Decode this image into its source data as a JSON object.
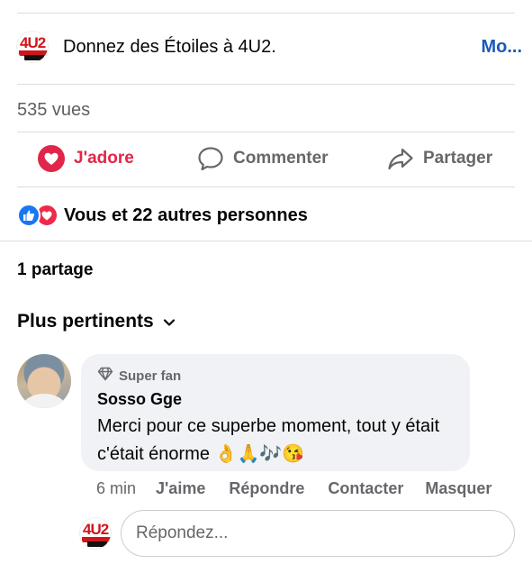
{
  "promo": {
    "page_logo_text": "4U2",
    "text": "Donnez des Étoiles à 4U2.",
    "more_label": "Mo..."
  },
  "stats": {
    "views": "535 vues",
    "reactions_text": "Vous et 22 autres personnes",
    "shares": "1 partage"
  },
  "actions": {
    "love_label": "J'adore",
    "comment_label": "Commenter",
    "share_label": "Partager"
  },
  "sort": {
    "label": "Plus pertinents"
  },
  "comment": {
    "badge": "Super fan",
    "author": "Sosso Gge",
    "text": "Merci pour ce superbe moment, tout y était c'était énorme 👌🙏🎶😘",
    "time": "6 min",
    "like_label": "J'aime",
    "reply_label": "Répondre",
    "contact_label": "Contacter",
    "hide_label": "Masquer"
  },
  "reply": {
    "placeholder": "Répondez..."
  },
  "colors": {
    "love": "#e0264a",
    "link": "#1a5ab8",
    "like_blue": "#1877f2",
    "muted": "#65676b"
  },
  "icons": [
    "heart-icon",
    "comment-bubble-icon",
    "share-arrow-icon",
    "like-reaction-icon",
    "love-reaction-icon",
    "chevron-down-icon",
    "diamond-icon"
  ]
}
